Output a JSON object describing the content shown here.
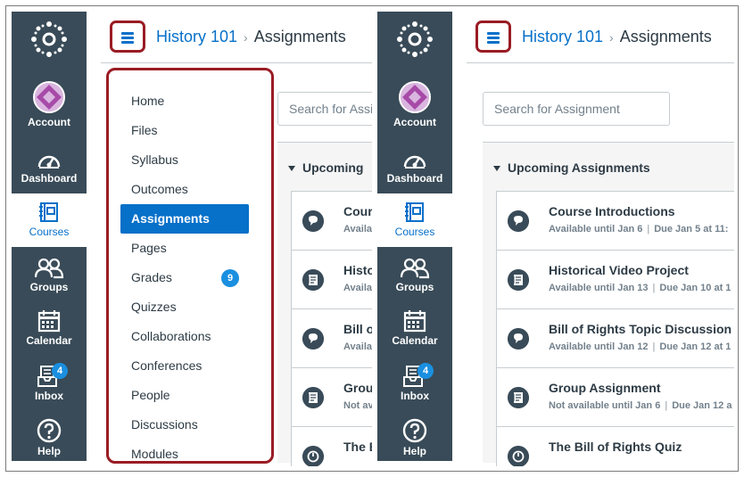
{
  "global_nav": {
    "account": "Account",
    "dashboard": "Dashboard",
    "courses": "Courses",
    "groups": "Groups",
    "calendar": "Calendar",
    "inbox": "Inbox",
    "inbox_badge": "4",
    "help": "Help"
  },
  "header": {
    "course_link": "History 101",
    "separator": "›",
    "current_page": "Assignments"
  },
  "search": {
    "placeholder_left": "Search for Assig",
    "placeholder_right": "Search for Assignment"
  },
  "section_title_left": "Upcoming",
  "section_title_right": "Upcoming Assignments",
  "course_menu": [
    {
      "label": "Home"
    },
    {
      "label": "Files"
    },
    {
      "label": "Syllabus"
    },
    {
      "label": "Outcomes"
    },
    {
      "label": "Assignments",
      "active": true
    },
    {
      "label": "Pages"
    },
    {
      "label": "Grades",
      "badge": "9"
    },
    {
      "label": "Quizzes"
    },
    {
      "label": "Collaborations"
    },
    {
      "label": "Conferences"
    },
    {
      "label": "People"
    },
    {
      "label": "Discussions"
    },
    {
      "label": "Modules"
    }
  ],
  "assignments_left": [
    {
      "title": "Cours",
      "meta": "Availa",
      "icon": "discussion-icon"
    },
    {
      "title": "Histo",
      "meta": "Availa",
      "icon": "assignment-icon"
    },
    {
      "title": "Bill o",
      "meta": "Availa",
      "icon": "discussion-icon"
    },
    {
      "title": "Group",
      "meta": "Not av",
      "icon": "assignment-icon"
    },
    {
      "title": "The B",
      "meta": "",
      "icon": "quiz-icon"
    }
  ],
  "assignments_right": [
    {
      "title": "Course Introductions",
      "avail": "Available until Jan 6",
      "due": "Due Jan 5 at 11:",
      "icon": "discussion-icon"
    },
    {
      "title": "Historical Video Project",
      "avail": "Available until Jan 13",
      "due": "Due Jan 10 at 1",
      "icon": "assignment-icon"
    },
    {
      "title": "Bill of Rights Topic Discussion",
      "avail": "Available until Jan 12",
      "due": "Due Jan 12 at 1",
      "icon": "discussion-icon"
    },
    {
      "title": "Group Assignment",
      "avail": "Not available until Jan 6",
      "due": "Due Jan 12 a",
      "icon": "assignment-icon"
    },
    {
      "title": "The Bill of Rights Quiz",
      "avail": "",
      "due": "",
      "icon": "quiz-icon"
    }
  ],
  "colors": {
    "nav_bg": "#394b58",
    "accent": "#0770c9",
    "highlight_border": "#9a1c24",
    "badge": "#1a8fe0"
  }
}
